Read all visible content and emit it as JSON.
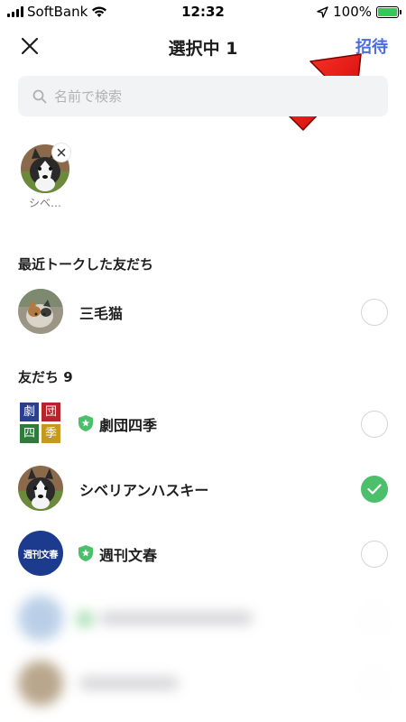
{
  "status_bar": {
    "carrier": "SoftBank",
    "time": "12:32",
    "battery": "100%"
  },
  "header": {
    "title": "選択中 1",
    "invite_label": "招待"
  },
  "search": {
    "placeholder": "名前で検索"
  },
  "selected_chip": {
    "name": "シベ…"
  },
  "recent": {
    "title": "最近トークした友だち",
    "items": [
      {
        "name": "三毛猫",
        "checked": false
      }
    ]
  },
  "friends": {
    "title": "友だち 9",
    "items": [
      {
        "name": "劇団四季",
        "official": true,
        "checked": false,
        "avatar_text": [
          "劇",
          "団",
          "四",
          "季"
        ]
      },
      {
        "name": "シベリアンハスキー",
        "official": false,
        "checked": true
      },
      {
        "name": "週刊文春",
        "official": true,
        "checked": false,
        "avatar_text": "週刊文春"
      }
    ]
  },
  "colors": {
    "accent_blue": "#4a6ee0",
    "check_green": "#4cbf6b",
    "official_badge": "#4cbf6b",
    "search_bg": "#f2f3f5"
  }
}
